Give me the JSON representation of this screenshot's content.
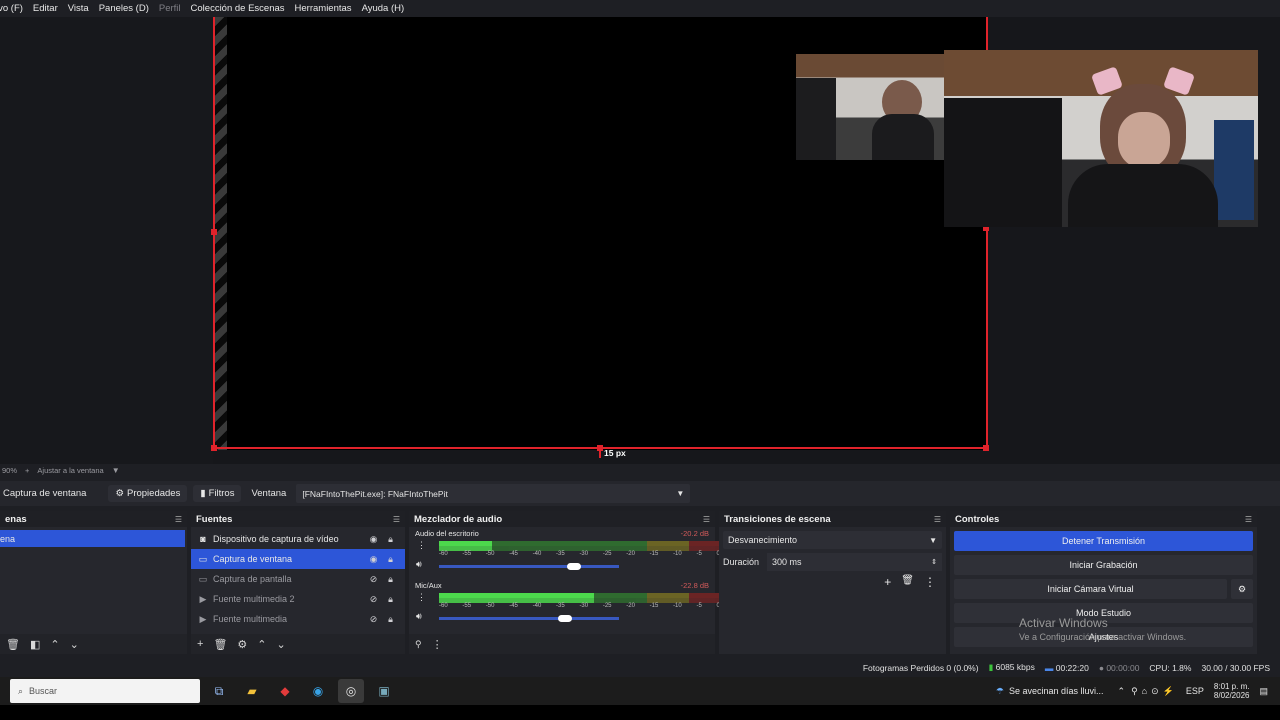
{
  "menubar": {
    "items": [
      "ivo (F)",
      "Editar",
      "Vista",
      "Paneles (D)",
      "Perfil",
      "Colección de Escenas",
      "Herramientas",
      "Ayuda (H)"
    ]
  },
  "preview": {
    "bottom_label": "15 px",
    "zoom": "90%",
    "fit_label": "Ajustar a la ventana"
  },
  "context": {
    "source_name": "Captura de ventana",
    "properties": "Propiedades",
    "filters": "Filtros",
    "window_label": "Ventana",
    "window_value": "[FNaFIntoThePit.exe]: FNaFIntoThePit"
  },
  "scenes": {
    "title": "enas",
    "selected": "ena"
  },
  "sources": {
    "title": "Fuentes",
    "items": [
      {
        "label": "Dispositivo de captura de vídeo",
        "icon": "camera-icon",
        "visible": true,
        "selected": false
      },
      {
        "label": "Captura de ventana",
        "icon": "window-icon",
        "visible": true,
        "selected": true
      },
      {
        "label": "Captura de pantalla",
        "icon": "monitor-icon",
        "visible": false,
        "selected": false
      },
      {
        "label": "Fuente multimedia 2",
        "icon": "play-icon",
        "visible": false,
        "selected": false
      },
      {
        "label": "Fuente multimedia",
        "icon": "play-icon",
        "visible": false,
        "selected": false
      }
    ]
  },
  "mixer": {
    "title": "Mezclador de audio",
    "scale": [
      "-60",
      "-55",
      "-50",
      "-45",
      "-40",
      "-35",
      "-30",
      "-25",
      "-20",
      "-15",
      "-10",
      "-5",
      "0"
    ],
    "channels": [
      {
        "name": "Audio del escritorio",
        "db": "-20.2 dB",
        "level": 0.19,
        "volume": 0.75
      },
      {
        "name": "Mic/Aux",
        "db": "-22.8 dB",
        "level": 0.55,
        "volume": 0.7
      }
    ]
  },
  "transitions": {
    "title": "Transiciones de escena",
    "selected": "Desvanecimiento",
    "duration_label": "Duración",
    "duration_value": "300 ms"
  },
  "controls": {
    "title": "Controles",
    "buttons": [
      "Detener Transmisión",
      "Iniciar Grabación",
      "Iniciar Cámara Virtual",
      "Modo Estudio",
      "Ajustes"
    ]
  },
  "watermark": {
    "title": "Activar Windows",
    "subtitle": "Ve a Configuración para activar Windows."
  },
  "status": {
    "dropped": "Fotogramas Perdidos 0 (0.0%)",
    "bitrate": "6085 kbps",
    "stream_time": "00:22:20",
    "rec_time": "00:00:00",
    "cpu": "CPU: 1.8%",
    "fps": "30.00 / 30.00 FPS"
  },
  "taskbar": {
    "search_placeholder": "Buscar",
    "weather": "Se avecinan días lluvi...",
    "lang": "ESP",
    "time": "8:01 p. m.",
    "date": "8/02/2026"
  },
  "colors": {
    "accent": "#2d56d8",
    "red": "#e0232b"
  }
}
